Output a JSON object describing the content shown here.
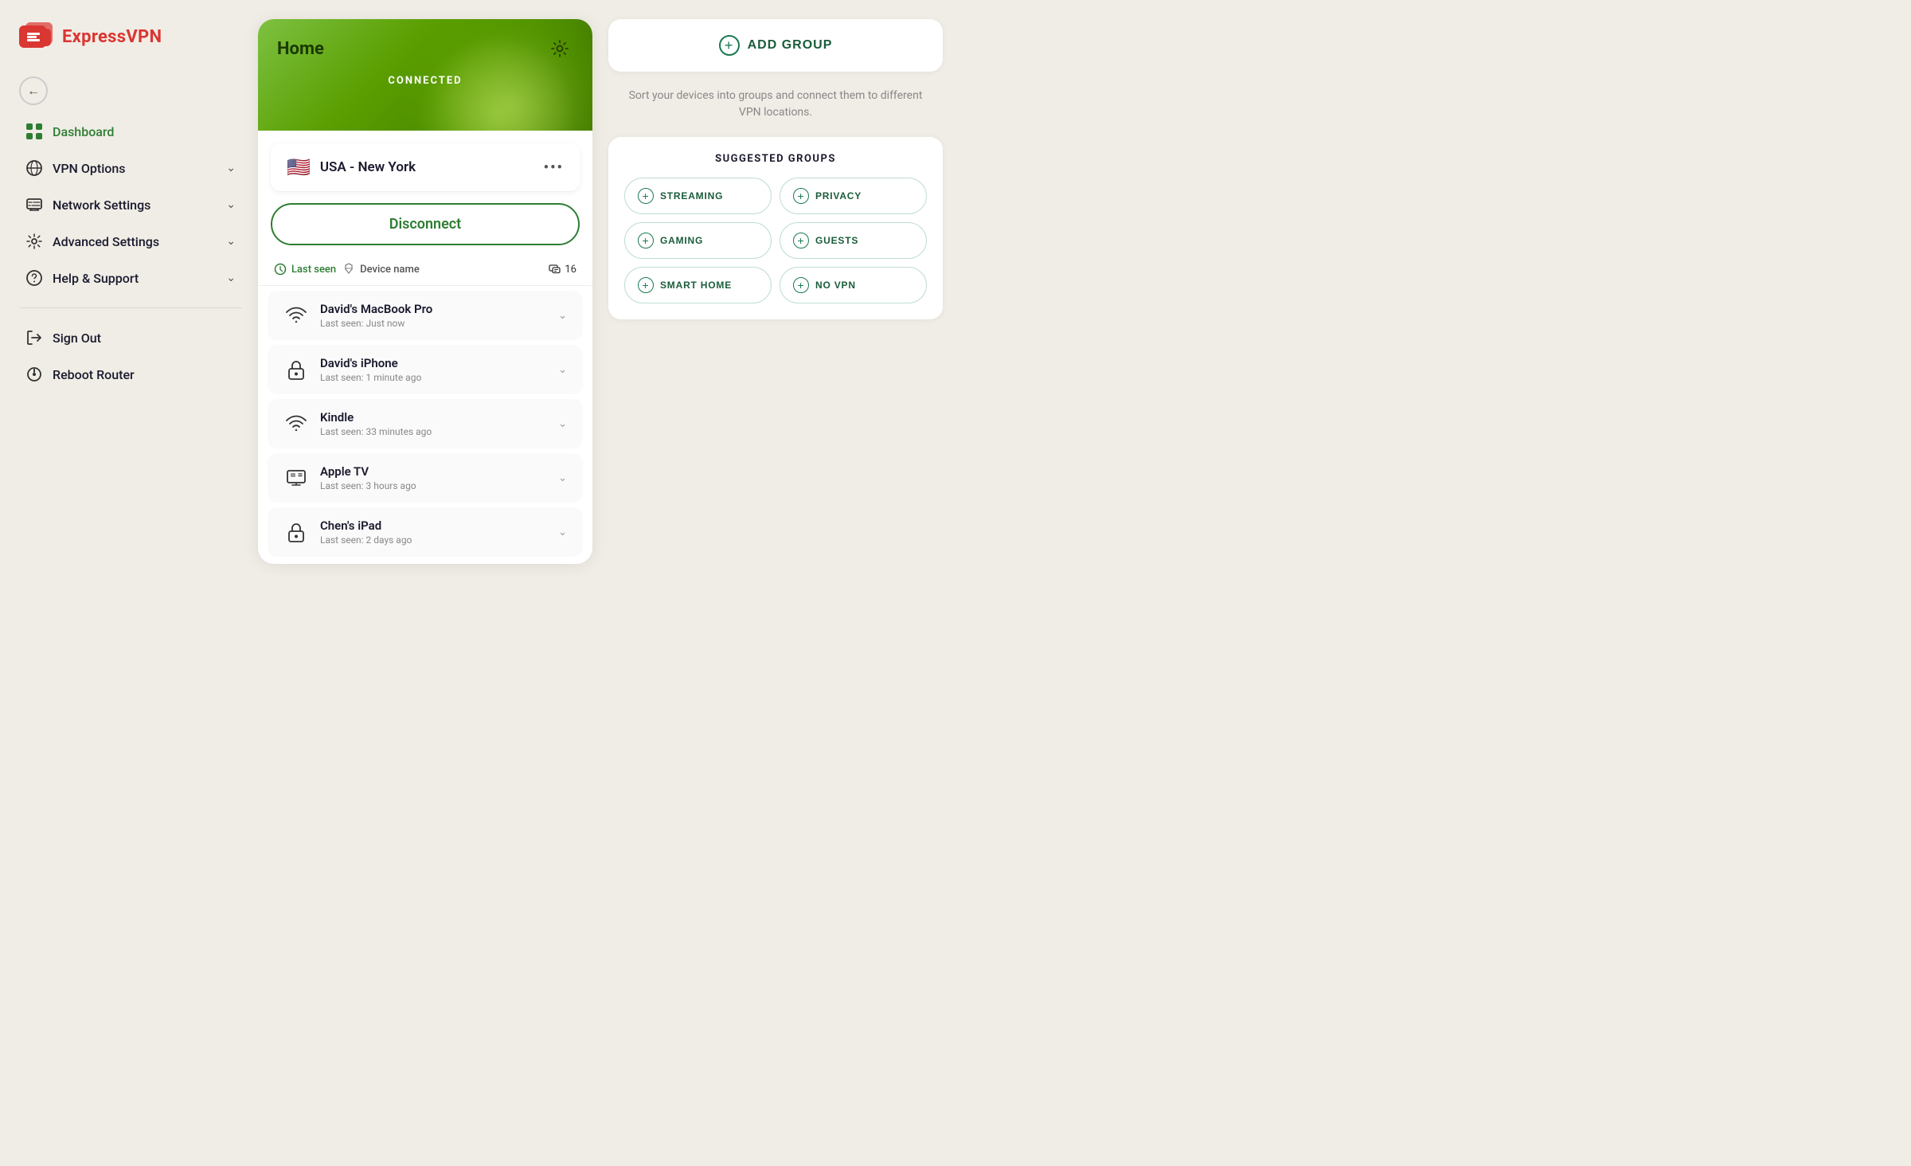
{
  "app": {
    "name": "ExpressVPN"
  },
  "sidebar": {
    "back_button": "←",
    "nav_items": [
      {
        "id": "dashboard",
        "label": "Dashboard",
        "active": true,
        "has_chevron": false
      },
      {
        "id": "vpn-options",
        "label": "VPN Options",
        "active": false,
        "has_chevron": true
      },
      {
        "id": "network-settings",
        "label": "Network Settings",
        "active": false,
        "has_chevron": true
      },
      {
        "id": "advanced-settings",
        "label": "Advanced Settings",
        "active": false,
        "has_chevron": true
      },
      {
        "id": "help-support",
        "label": "Help & Support",
        "active": false,
        "has_chevron": true
      }
    ],
    "bottom_items": [
      {
        "id": "sign-out",
        "label": "Sign Out"
      },
      {
        "id": "reboot-router",
        "label": "Reboot Router"
      }
    ]
  },
  "main_card": {
    "title": "Home",
    "status": "CONNECTED",
    "location": {
      "flag": "🇺🇸",
      "name": "USA - New York"
    },
    "disconnect_button": "Disconnect",
    "devices_header": {
      "last_seen": "Last seen",
      "device_name": "Device name",
      "count": "16"
    },
    "devices": [
      {
        "name": "David's MacBook Pro",
        "last_seen": "Last seen: Just now",
        "icon_type": "wifi"
      },
      {
        "name": "David's iPhone",
        "last_seen": "Last seen: 1 minute ago",
        "icon_type": "lock"
      },
      {
        "name": "Kindle",
        "last_seen": "Last seen: 33 minutes ago",
        "icon_type": "wifi"
      },
      {
        "name": "Apple TV",
        "last_seen": "Last seen: 3 hours ago",
        "icon_type": "tv"
      },
      {
        "name": "Chen's iPad",
        "last_seen": "Last seen: 2 days ago",
        "icon_type": "lock"
      }
    ]
  },
  "right_panel": {
    "add_group_button": "ADD GROUP",
    "sort_hint": "Sort your devices into groups and connect them to different VPN locations.",
    "suggested_groups_title": "SUGGESTED GROUPS",
    "suggested_groups": [
      {
        "id": "streaming",
        "label": "STREAMING"
      },
      {
        "id": "privacy",
        "label": "PRIVACY"
      },
      {
        "id": "gaming",
        "label": "GAMING"
      },
      {
        "id": "guests",
        "label": "GUESTS"
      },
      {
        "id": "smart-home",
        "label": "SMART HOME"
      },
      {
        "id": "no-vpn",
        "label": "NO VPN"
      }
    ]
  }
}
